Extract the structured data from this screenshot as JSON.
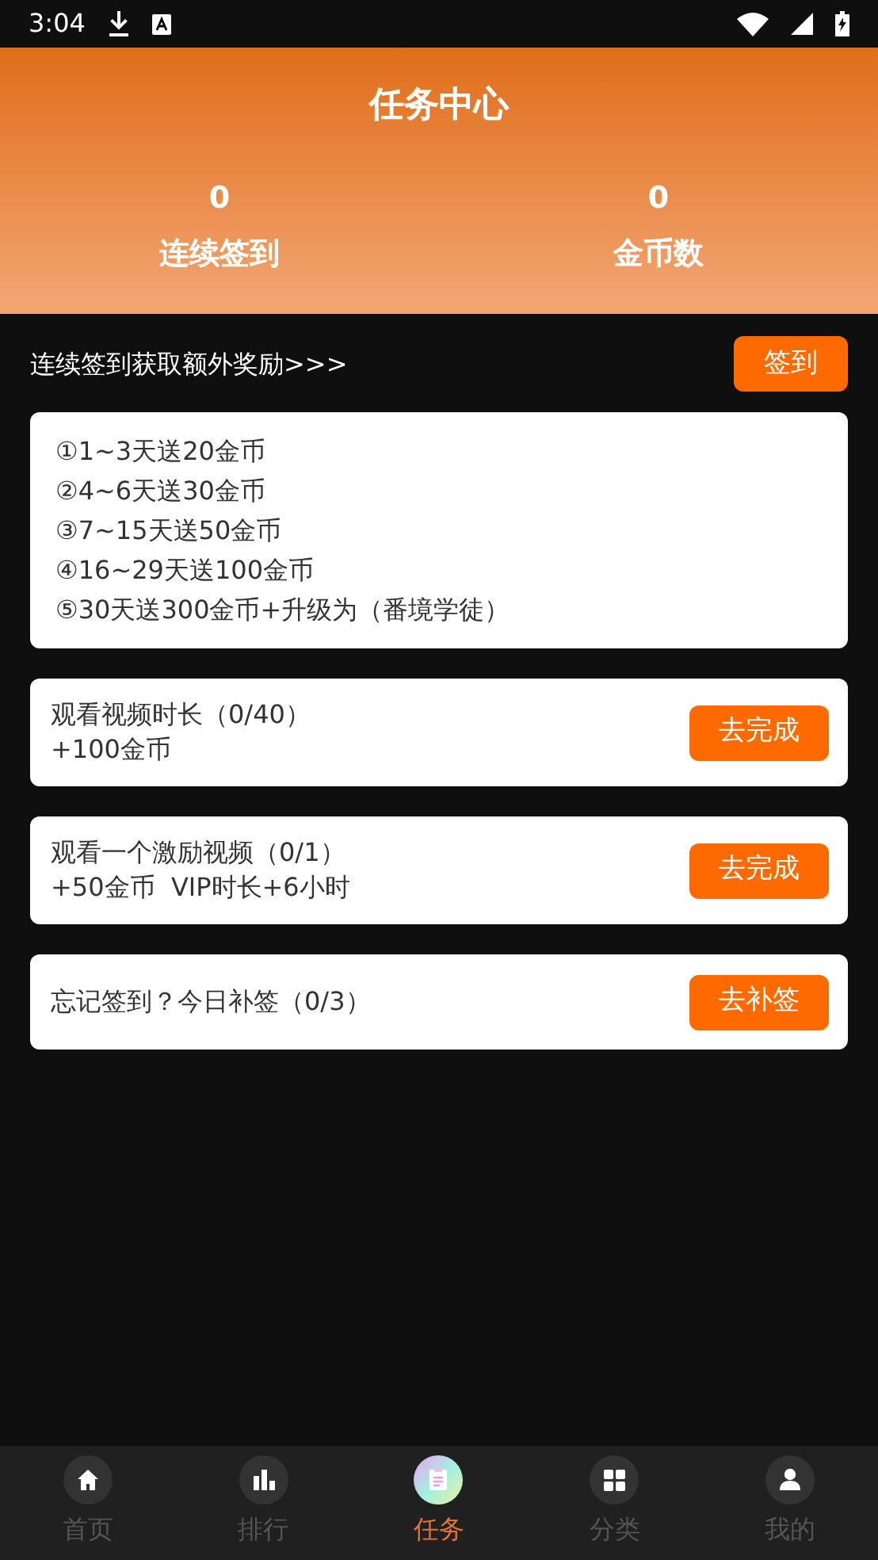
{
  "status_bar": {
    "time": "3:04"
  },
  "header": {
    "title": "任务中心",
    "stats": [
      {
        "value": "0",
        "label": "连续签到"
      },
      {
        "value": "0",
        "label": "金币数"
      }
    ]
  },
  "sign_in": {
    "text": "连续签到获取额外奖励>>>",
    "button": "签到"
  },
  "rules": [
    "①1~3天送20金币",
    "②4~6天送30金币",
    "③7~15天送50金币",
    "④16~29天送100金币",
    "⑤30天送300金币+升级为（番境学徒）"
  ],
  "tasks": [
    {
      "lines": [
        "观看视频时长（0/40）",
        "+100金币"
      ],
      "button": "去完成"
    },
    {
      "lines": [
        "观看一个激励视频（0/1）",
        "+50金币  VIP时长+6小时"
      ],
      "button": "去完成"
    },
    {
      "lines": [
        "忘记签到？今日补签（0/3）"
      ],
      "button": "去补签"
    }
  ],
  "bottom_nav": [
    {
      "kind": "home",
      "label": "首页",
      "selected": false
    },
    {
      "kind": "chart",
      "label": "排行",
      "selected": false
    },
    {
      "kind": "tasks",
      "label": "任务",
      "selected": true
    },
    {
      "kind": "grid",
      "label": "分类",
      "selected": false
    },
    {
      "kind": "profile",
      "label": "我的",
      "selected": false
    }
  ]
}
